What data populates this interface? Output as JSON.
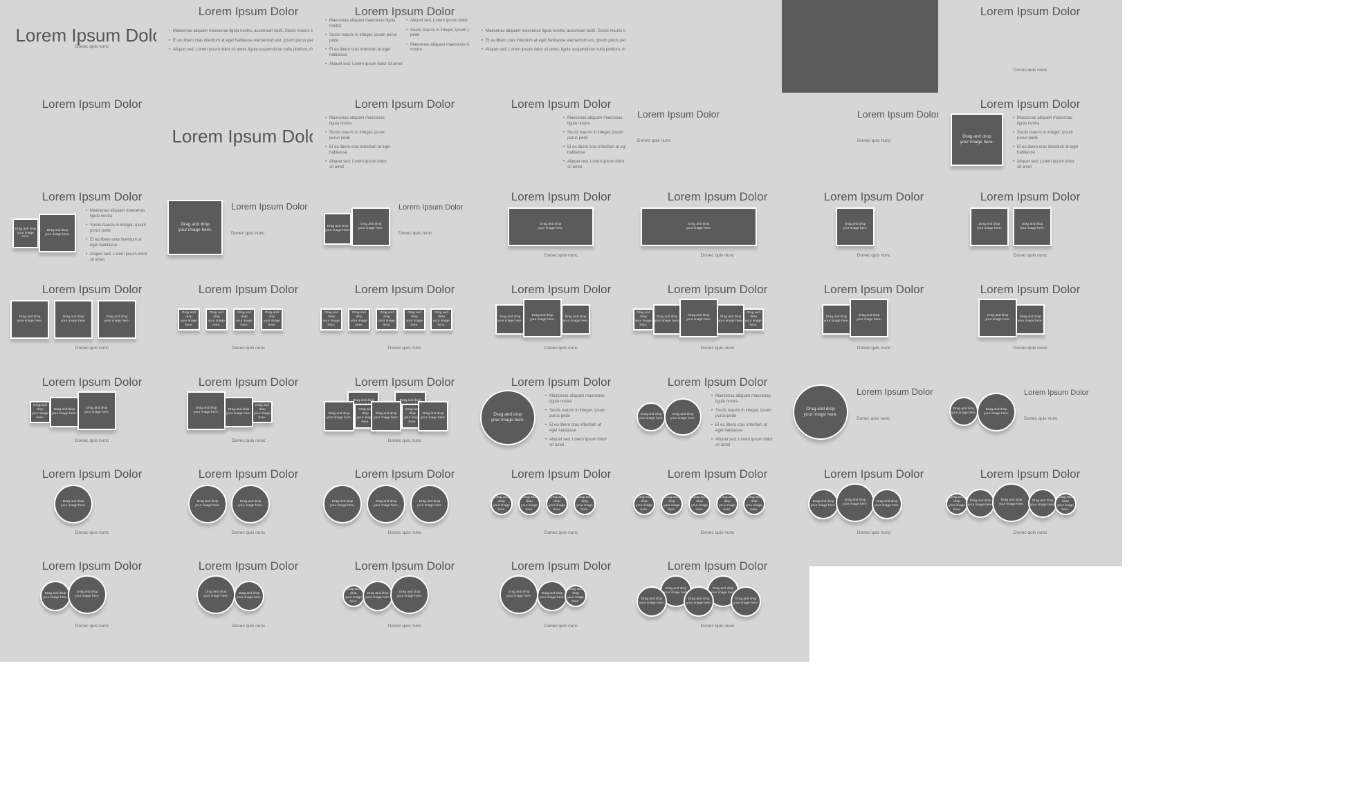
{
  "texts": {
    "title": "Lorem Ipsum Dolor",
    "subtitle": "Donec quis nunc",
    "placeholder": "Drag and drop\nyour image here."
  },
  "bullets_long": [
    "Maecenas aliquam maecenas ligula nostra, accumsan taciti. Sociis mauris in integer",
    "El eu libero cras interdum at eget habitasse elementum est, ipsum purus pede",
    "Aliquet sed. Lorem ipsum dolor sit amet, ligula suspendisse nulla pretium, rhoncus"
  ],
  "bullets_short": [
    "Maecenas aliquam maecenas ligula nostra",
    "Sociis mauris in integer, ipsum purus pede",
    "El eu libero cras interdum at eget habitasse",
    "Aliquet sed. Lorem ipsum dolor sit amet"
  ],
  "bullets_col2": [
    "Aliquet sed. Lorem ipsum dolor sit amet",
    "Sociis mauris in integer, ipsum purus pede",
    "Maecenas aliquam maecenas ligula nostra"
  ],
  "colors": {
    "slide_background": "#d6d6d6",
    "dark_slide_background": "#5a5a5a",
    "placeholder_fill": "#5b5b5b",
    "placeholder_border": "#ffffff",
    "title_text": "#555555"
  }
}
